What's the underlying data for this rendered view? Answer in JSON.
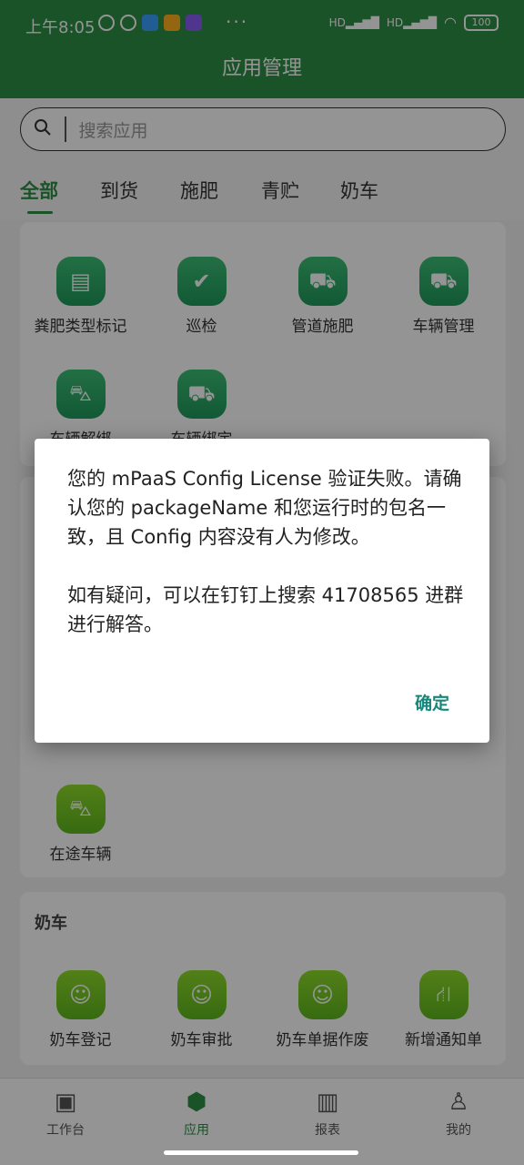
{
  "status": {
    "time": "上午8:05",
    "dots": "···",
    "hd1": "HD",
    "hd2": "HD",
    "battery": "100"
  },
  "header": {
    "title": "应用管理"
  },
  "search": {
    "placeholder": "搜索应用"
  },
  "tabs": [
    "全部",
    "到货",
    "施肥",
    "青贮",
    "奶车"
  ],
  "section1": {
    "apps": [
      {
        "label": "粪肥类型标记",
        "icon": "clipboard-icon"
      },
      {
        "label": "巡检",
        "icon": "inspection-icon"
      },
      {
        "label": "管道施肥",
        "icon": "truck-icon"
      },
      {
        "label": "车辆管理",
        "icon": "truck-icon"
      },
      {
        "label": "车辆解绑",
        "icon": "car-unbind-icon"
      },
      {
        "label": "车辆绑定",
        "icon": "truck-icon"
      }
    ]
  },
  "section2": {
    "apps": [
      {
        "label": "在途车辆",
        "icon": "car-icon"
      }
    ]
  },
  "section3": {
    "title": "奶车",
    "apps": [
      {
        "label": "奶车登记",
        "icon": "user-check-icon"
      },
      {
        "label": "奶车审批",
        "icon": "user-check-icon"
      },
      {
        "label": "奶车单据作废",
        "icon": "user-check-icon"
      },
      {
        "label": "新增通知单",
        "icon": "road-icon"
      }
    ]
  },
  "nav": [
    "工作台",
    "应用",
    "报表",
    "我的"
  ],
  "dialog": {
    "message": "您的 mPaaS Config License 验证失败。请确认您的 packageName 和您运行时的包名一致，且 Config 内容没有人为修改。\n\n如有疑问，可以在钉钉上搜索 41708565 进群进行解答。",
    "ok": "确定"
  }
}
